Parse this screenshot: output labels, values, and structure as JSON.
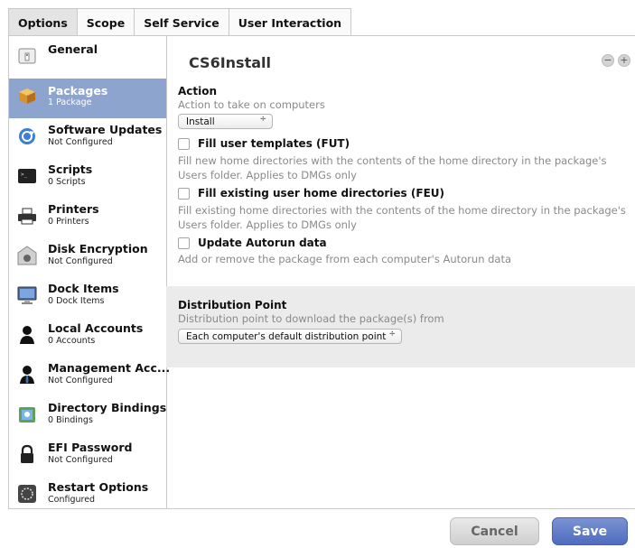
{
  "tabs": [
    "Options",
    "Scope",
    "Self Service",
    "User Interaction"
  ],
  "sidebar": {
    "items": [
      {
        "title": "General",
        "sub": "",
        "icon": "general-icon"
      },
      {
        "title": "Packages",
        "sub": "1 Package",
        "icon": "package-icon",
        "selected": true
      },
      {
        "title": "Software Updates",
        "sub": "Not Configured",
        "icon": "software-update-icon"
      },
      {
        "title": "Scripts",
        "sub": "0 Scripts",
        "icon": "terminal-icon"
      },
      {
        "title": "Printers",
        "sub": "0 Printers",
        "icon": "printer-icon"
      },
      {
        "title": "Disk Encryption",
        "sub": "Not Configured",
        "icon": "disk-encryption-icon"
      },
      {
        "title": "Dock Items",
        "sub": "0 Dock Items",
        "icon": "dock-icon"
      },
      {
        "title": "Local Accounts",
        "sub": "0 Accounts",
        "icon": "user-icon"
      },
      {
        "title": "Management Acc...",
        "sub": "Not Configured",
        "icon": "management-account-icon"
      },
      {
        "title": "Directory Bindings",
        "sub": "0 Bindings",
        "icon": "directory-icon"
      },
      {
        "title": "EFI Password",
        "sub": "Not Configured",
        "icon": "lock-icon"
      },
      {
        "title": "Restart Options",
        "sub": "Configured",
        "icon": "restart-icon"
      }
    ]
  },
  "main": {
    "package_title": "CS6Install",
    "remove_label": "−",
    "add_label": "+",
    "action": {
      "label": "Action",
      "desc": "Action to take on computers",
      "value": "Install",
      "arrow": "÷"
    },
    "checkboxes": [
      {
        "label": "Fill user templates (FUT)",
        "desc": "Fill new home directories with the contents of the home directory in the package's Users folder. Applies to DMGs only",
        "checked": false
      },
      {
        "label": "Fill existing user home directories (FEU)",
        "desc": "Fill existing home directories with the contents of the home directory in the package's Users folder. Applies to DMGs only",
        "checked": false
      },
      {
        "label": "Update Autorun data",
        "desc": "Add or remove the package from each computer's Autorun data",
        "checked": false
      }
    ],
    "distribution": {
      "label": "Distribution Point",
      "desc": "Distribution point to download the package(s) from",
      "value": "Each computer's default distribution point",
      "arrow": "÷"
    }
  },
  "footer": {
    "cancel_label": "Cancel",
    "save_label": "Save"
  },
  "colors": {
    "selected_bg": "#8da4cf",
    "save_button": "#5a76c6",
    "distribution_bg": "#ebebeb"
  }
}
